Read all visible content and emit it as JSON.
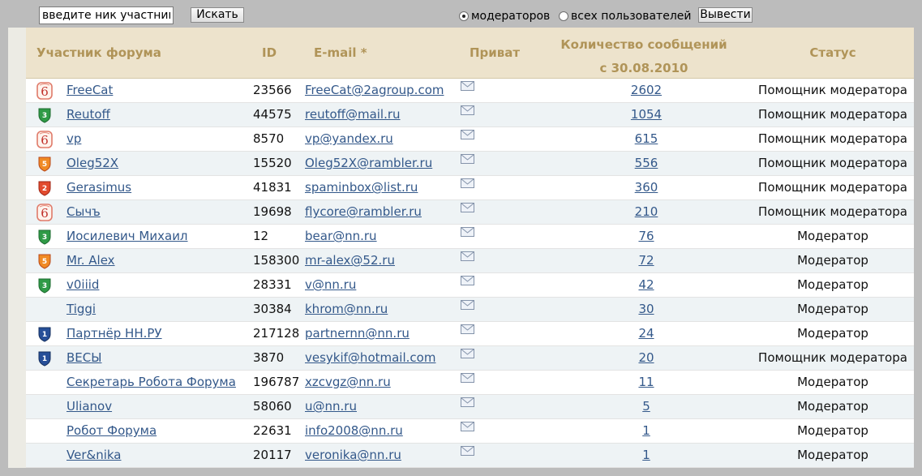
{
  "toolbar": {
    "search_value": "введите ник участника",
    "search_button": "Искать",
    "radio_moderators": "модераторов",
    "radio_all_users": "всех пользователей",
    "show_button": "Вывести"
  },
  "table": {
    "headers": {
      "name": "Участник форума",
      "id": "ID",
      "email": "E-mail *",
      "private": "Приват",
      "count_line1": "Количество сообщений",
      "count_line2": "с 30.08.2010",
      "status": "Статус"
    },
    "rows": [
      {
        "badge": "6-swirl",
        "name": "FreeCat",
        "id": "23566",
        "email": "FreeCat@2agroup.com",
        "count": "2602",
        "status": "Помощник модератора"
      },
      {
        "badge": "3-green",
        "name": "Reutoff",
        "id": "44575",
        "email": "reutoff@mail.ru",
        "count": "1054",
        "status": "Помощник модератора"
      },
      {
        "badge": "6-swirl",
        "name": "vp",
        "id": "8570",
        "email": "vp@yandex.ru",
        "count": "615",
        "status": "Помощник модератора"
      },
      {
        "badge": "5-orange",
        "name": "Oleg52X",
        "id": "15520",
        "email": "Oleg52X@rambler.ru",
        "count": "556",
        "status": "Помощник модератора"
      },
      {
        "badge": "2-red",
        "name": "Gerasimus",
        "id": "41831",
        "email": "spaminbox@list.ru",
        "count": "360",
        "status": "Помощник модератора"
      },
      {
        "badge": "6-swirl",
        "name": "Сычъ",
        "id": "19698",
        "email": "flycore@rambler.ru",
        "count": "210",
        "status": "Помощник модератора"
      },
      {
        "badge": "3-green",
        "name": "Иосилевич Михаил",
        "id": "12",
        "email": "bear@nn.ru",
        "count": "76",
        "status": "Модератор"
      },
      {
        "badge": "5-orange",
        "name": "Mr. Alex",
        "id": "158300",
        "email": "mr-alex@52.ru",
        "count": "72",
        "status": "Модератор"
      },
      {
        "badge": "3-green",
        "name": "v0iiid",
        "id": "28331",
        "email": "v@nn.ru",
        "count": "42",
        "status": "Модератор"
      },
      {
        "badge": "",
        "name": "Tiggi",
        "id": "30384",
        "email": "khrom@nn.ru",
        "count": "30",
        "status": "Модератор"
      },
      {
        "badge": "1-blue",
        "name": "Партнёр НН.РУ",
        "id": "217128",
        "email": "partnernn@nn.ru",
        "count": "24",
        "status": "Модератор"
      },
      {
        "badge": "1-blue",
        "name": "ВЕСЫ",
        "id": "3870",
        "email": "vesykif@hotmail.com",
        "count": "20",
        "status": "Помощник модератора"
      },
      {
        "badge": "",
        "name": "Секретарь Робота Форума",
        "id": "196787",
        "email": "xzcvgz@nn.ru",
        "count": "11",
        "status": "Модератор"
      },
      {
        "badge": "",
        "name": "Ulianov",
        "id": "58060",
        "email": "u@nn.ru",
        "count": "5",
        "status": "Модератор"
      },
      {
        "badge": "",
        "name": "Робот Форума",
        "id": "22631",
        "email": "info2008@nn.ru",
        "count": "1",
        "status": "Модератор"
      },
      {
        "badge": "",
        "name": "Ver&nika",
        "id": "20117",
        "email": "veronika@nn.ru",
        "count": "1",
        "status": "Модератор"
      }
    ]
  },
  "colors": {
    "header_bg": "#ede3cc",
    "header_text": "#b09458",
    "link": "#33588a",
    "row_alt": "#eef3f5"
  }
}
